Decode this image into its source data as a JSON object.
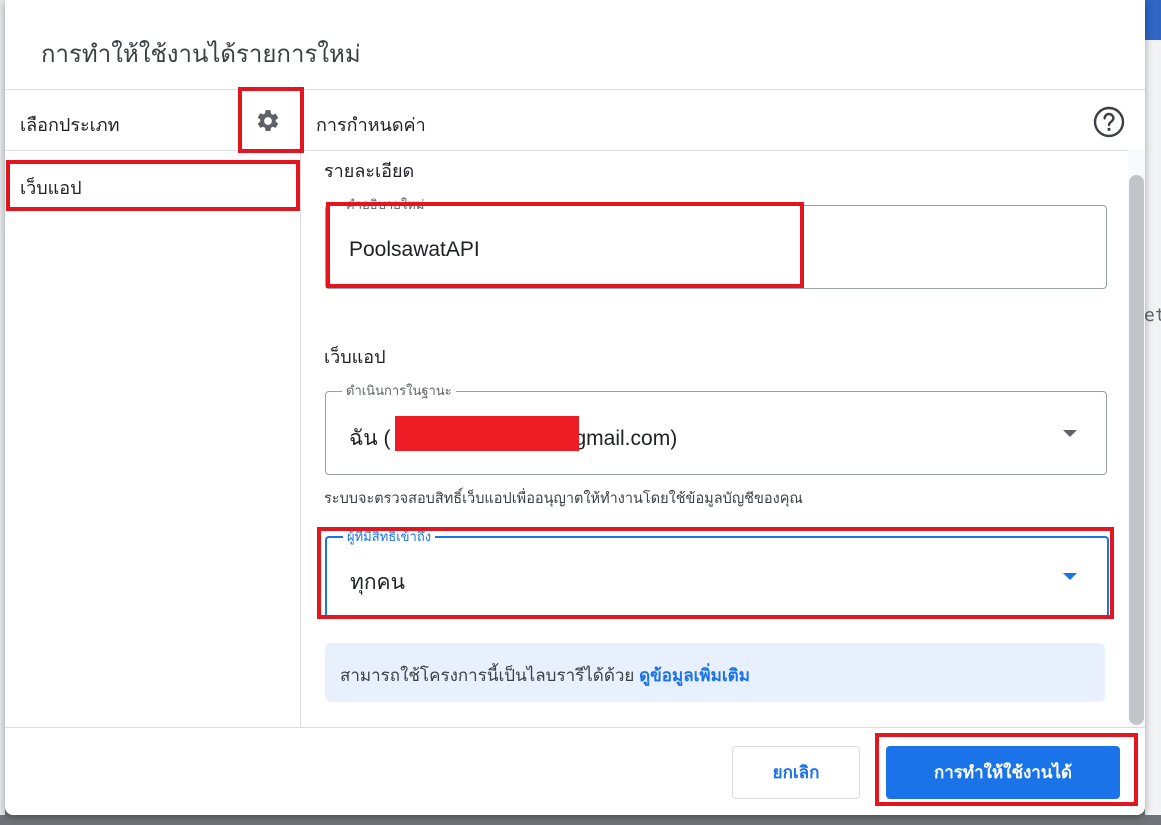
{
  "dialog": {
    "title": "การทำให้ใช้งานได้รายการใหม่",
    "left_header": "เลือกประเภท",
    "right_header": "การกำหนดค่า",
    "nav_items": [
      {
        "label": "เว็บแอป"
      }
    ],
    "details_section": "รายละเอียด",
    "description_field": {
      "label": "คำอธิบายใหม่",
      "value": "PoolsawatAPI"
    },
    "webapp_section": "เว็บแอป",
    "execute_as": {
      "label": "ดำเนินการในฐานะ",
      "value_prefix": "ฉัน (",
      "value_suffix": "gmail.com)"
    },
    "execute_helper": "ระบบจะตรวจสอบสิทธิ์เว็บแอปเพื่ออนุญาตให้ทำงานโดยใช้ข้อมูลบัญชีของคุณ",
    "access": {
      "label": "ผู้ที่มีสิทธิ์เข้าถึง",
      "value": "ทุกคน"
    },
    "info": {
      "text": "สามารถใช้โครงการนี้เป็นไลบรารีได้ด้วย",
      "link": "ดูข้อมูลเพิ่มเติม"
    },
    "cancel_label": "ยกเลิก",
    "deploy_label": "การทำให้ใช้งานได้"
  },
  "background": {
    "right_text": "et"
  },
  "colors": {
    "accent": "#1a73e8",
    "annotation_red": "#e3151f",
    "info_bg": "#e8f0fe"
  },
  "icons": {
    "settings": "gear-icon",
    "help": "help-icon",
    "dropdown": "dropdown-arrow-icon"
  }
}
